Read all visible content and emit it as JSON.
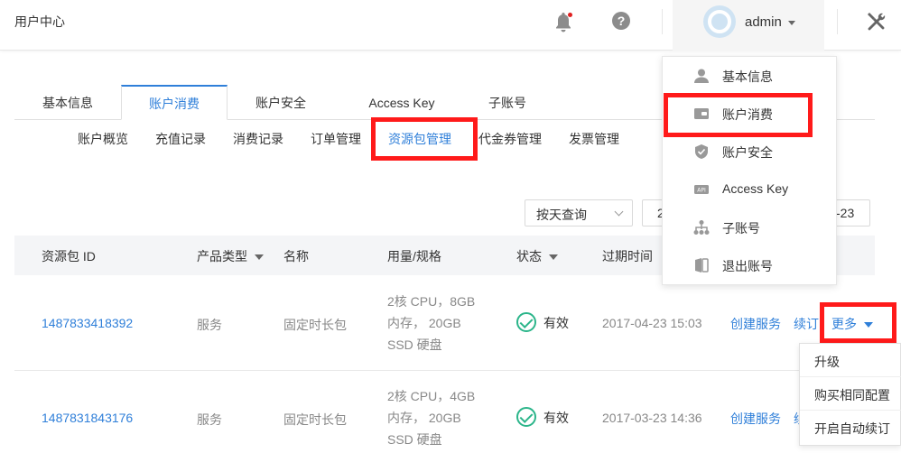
{
  "header": {
    "title": "用户中心",
    "username": "admin"
  },
  "tabs": [
    {
      "label": "基本信息",
      "active": false
    },
    {
      "label": "账户消费",
      "active": true
    },
    {
      "label": "账户安全",
      "active": false
    },
    {
      "label": "Access Key",
      "active": false
    },
    {
      "label": "子账号",
      "active": false
    }
  ],
  "subtabs": [
    {
      "label": "账户概览"
    },
    {
      "label": "充值记录"
    },
    {
      "label": "消费记录"
    },
    {
      "label": "订单管理"
    },
    {
      "label": "资源包管理",
      "active": true
    },
    {
      "label": "代金券管理"
    },
    {
      "label": "发票管理"
    }
  ],
  "filter": {
    "query_mode": "按天查询",
    "date_start": "2",
    "date_end": "-23"
  },
  "table": {
    "headers": {
      "id": "资源包 ID",
      "product_type": "产品类型",
      "name": "名称",
      "usage": "用量/规格",
      "status": "状态",
      "expire": "过期时间"
    },
    "rows": [
      {
        "id": "1487833418392",
        "product_type": "服务",
        "name": "固定时长包",
        "spec_line1": "2核 CPU，8GB",
        "spec_line2": "内存， 20GB",
        "spec_line3": "SSD 硬盘",
        "status": "有效",
        "expire": "2017-04-23 15:03",
        "action_create": "创建服务",
        "action_renew": "续订",
        "action_more": "更多"
      },
      {
        "id": "1487831843176",
        "product_type": "服务",
        "name": "固定时长包",
        "spec_line1": "2核 CPU，4GB",
        "spec_line2": "内存， 20GB",
        "spec_line3": "SSD 硬盘",
        "status": "有效",
        "expire": "2017-03-23 14:36",
        "action_create": "创建服务",
        "action_renew": "续"
      }
    ]
  },
  "user_menu": {
    "items": [
      {
        "label": "基本信息",
        "icon": "user-icon"
      },
      {
        "label": "账户消费",
        "icon": "wallet-icon"
      },
      {
        "label": "账户安全",
        "icon": "shield-icon"
      },
      {
        "label": "Access Key",
        "icon": "api-icon"
      },
      {
        "label": "子账号",
        "icon": "org-tree-icon"
      },
      {
        "label": "退出账号",
        "icon": "logout-icon"
      }
    ]
  },
  "more_menu": {
    "items": [
      {
        "label": "升级"
      },
      {
        "label": "购买相同配置"
      },
      {
        "label": "开启自动续订"
      }
    ]
  },
  "colors": {
    "accent": "#2f7fd9",
    "highlight": "#ff1a1a",
    "status_ok": "#2bb58a"
  }
}
